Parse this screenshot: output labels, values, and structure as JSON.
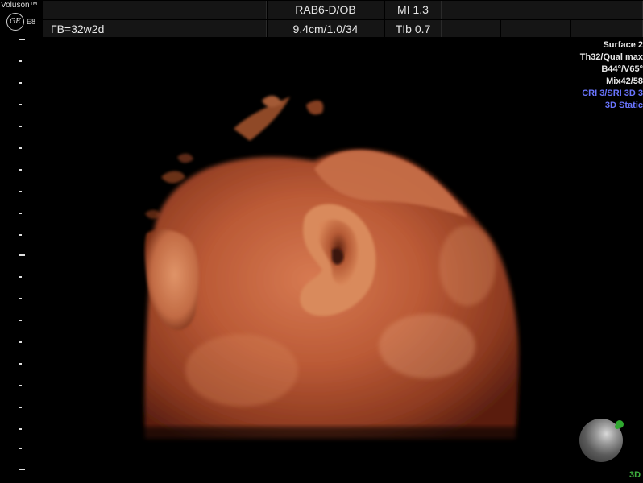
{
  "system": {
    "brand": "Voluson™",
    "logo_text": "GE",
    "model": "E8"
  },
  "header": {
    "gestational_age": "ГВ=32w2d",
    "probe": "RAB6-D/OB",
    "depth_info": "9.4cm/1.0/34",
    "mi": "MI  1.3",
    "tib": "TIb  0.7"
  },
  "render_params": {
    "surface": "Surface 2",
    "threshold_quality": "Th32/Qual max",
    "angles": "B44°/V65°",
    "mix": "Mix42/58",
    "cri_sri": "CRI 3/SRI 3D 3",
    "acquisition_mode": "3D Static"
  },
  "indicators": {
    "mode_label": "3D"
  },
  "colors": {
    "background": "#000000",
    "tissue": "#c0603b",
    "highlight_blue": "#6a75ff",
    "green_indicator": "#3fb13f"
  }
}
